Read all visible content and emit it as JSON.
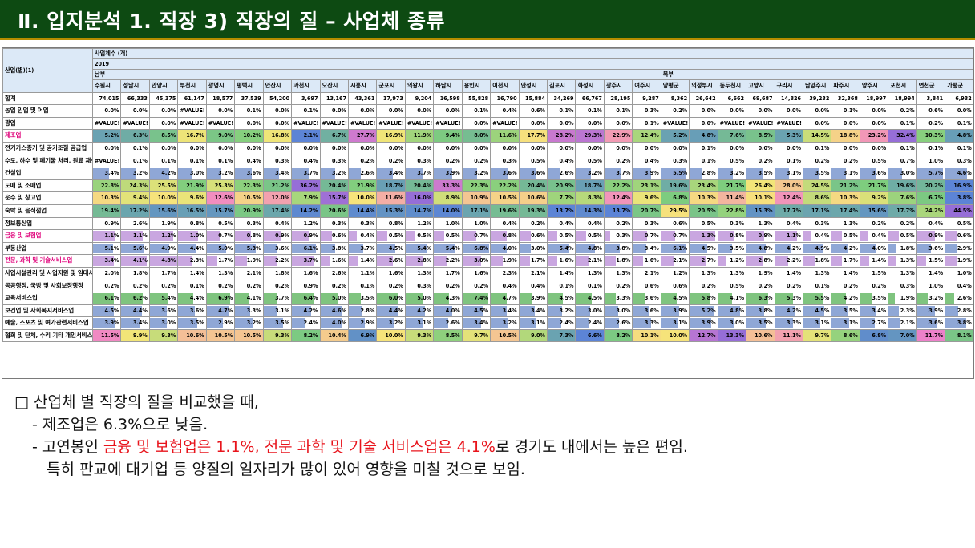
{
  "header": {
    "title": "Ⅱ. 입지분석 1. 직장 3) 직장의 질 – 사업체 종류",
    "bg_color": "#0d4a12",
    "rule_color": "#b58d00"
  },
  "table": {
    "corner_label": "산업(별)(1)",
    "top_header": "사업체수 (개)",
    "year": "2019",
    "region_south": "남부",
    "region_north": "북부",
    "south_count": 20,
    "cities": [
      "수원시",
      "성남시",
      "안양시",
      "부천시",
      "광명시",
      "평택시",
      "안산시",
      "과천시",
      "오산시",
      "시흥시",
      "군포시",
      "의왕시",
      "하남시",
      "용인시",
      "이천시",
      "안성시",
      "김포시",
      "화성시",
      "광주시",
      "여주시",
      "양평군",
      "의정부시",
      "동두천시",
      "고양시",
      "구리시",
      "남양주시",
      "파주시",
      "양주시",
      "포천시",
      "연천군",
      "가평군"
    ],
    "rows": [
      {
        "label": "합계",
        "type": "plain",
        "values": [
          "74,015",
          "66,333",
          "45,375",
          "61,147",
          "18,577",
          "37,539",
          "54,200",
          "3,697",
          "13,167",
          "43,361",
          "17,973",
          "9,204",
          "16,598",
          "55,828",
          "16,790",
          "15,884",
          "34,269",
          "66,767",
          "28,195",
          "9,287",
          "8,362",
          "26,642",
          "6,662",
          "69,687",
          "14,826",
          "39,232",
          "32,368",
          "18,997",
          "18,994",
          "3,841",
          "6,932"
        ]
      },
      {
        "label": "농업 임업 및 어업",
        "type": "plain",
        "values": [
          "0.0%",
          "0.0%",
          "0.0%",
          "#VALUE!",
          "0.0%",
          "0.1%",
          "0.0%",
          "0.1%",
          "0.0%",
          "0.0%",
          "0.0%",
          "0.0%",
          "0.0%",
          "0.1%",
          "0.4%",
          "0.6%",
          "0.1%",
          "0.1%",
          "0.1%",
          "0.3%",
          "0.2%",
          "0.0%",
          "0.0%",
          "0.0%",
          "0.0%",
          "0.0%",
          "0.1%",
          "0.0%",
          "0.2%",
          "0.6%",
          "0.0%"
        ]
      },
      {
        "label": "광업",
        "type": "plain",
        "values": [
          "#VALUE!",
          "#VALUE!",
          "0.0%",
          "#VALUE!",
          "#VALUE!",
          "0.0%",
          "0.0%",
          "#VALUE!",
          "#VALUE!",
          "#VALUE!",
          "#VALUE!",
          "#VALUE!",
          "#VALUE!",
          "0.0%",
          "#VALUE!",
          "0.0%",
          "0.0%",
          "0.0%",
          "0.0%",
          "0.1%",
          "#VALUE!",
          "0.0%",
          "#VALUE!",
          "#VALUE!",
          "#VALUE!",
          "0.0%",
          "0.0%",
          "0.0%",
          "0.1%",
          "0.2%",
          "0.1%"
        ]
      },
      {
        "label": "제조업",
        "type": "heat",
        "key": "manufacturing",
        "values": [
          "5.2%",
          "6.3%",
          "8.5%",
          "16.7%",
          "9.0%",
          "10.2%",
          "16.8%",
          "2.1%",
          "6.7%",
          "27.7%",
          "16.9%",
          "11.9%",
          "9.4%",
          "8.0%",
          "11.6%",
          "17.7%",
          "28.2%",
          "29.3%",
          "22.9%",
          "12.4%",
          "5.2%",
          "4.8%",
          "7.6%",
          "8.5%",
          "5.3%",
          "14.5%",
          "18.8%",
          "23.2%",
          "32.4%",
          "10.3%",
          "4.8%"
        ]
      },
      {
        "label": "전기가스증기 및 공기조절 공급업",
        "type": "plain",
        "values": [
          "0.0%",
          "0.1%",
          "0.0%",
          "0.0%",
          "0.0%",
          "0.0%",
          "0.0%",
          "0.0%",
          "0.0%",
          "0.0%",
          "0.0%",
          "0.0%",
          "0.0%",
          "0.0%",
          "0.0%",
          "0.0%",
          "0.0%",
          "0.0%",
          "0.0%",
          "0.0%",
          "0.0%",
          "0.1%",
          "0.0%",
          "0.0%",
          "0.0%",
          "0.1%",
          "0.0%",
          "0.0%",
          "0.1%",
          "0.1%",
          "0.1%"
        ]
      },
      {
        "label": "수도, 하수 및 폐기물 처리, 원료 재생업",
        "type": "plain",
        "values": [
          "#VALUE!",
          "0.1%",
          "0.1%",
          "0.1%",
          "0.1%",
          "0.4%",
          "0.3%",
          "0.4%",
          "0.3%",
          "0.2%",
          "0.2%",
          "0.3%",
          "0.2%",
          "0.2%",
          "0.3%",
          "0.5%",
          "0.4%",
          "0.5%",
          "0.2%",
          "0.4%",
          "0.3%",
          "0.1%",
          "0.5%",
          "0.2%",
          "0.1%",
          "0.2%",
          "0.2%",
          "0.5%",
          "0.7%",
          "1.0%",
          "0.3%"
        ]
      },
      {
        "label": "건설업",
        "type": "bar",
        "color": "#8fa7d6",
        "max": 6,
        "values": [
          "3.4%",
          "3.2%",
          "4.2%",
          "3.0%",
          "3.2%",
          "3.6%",
          "3.4%",
          "3.7%",
          "3.2%",
          "2.6%",
          "3.4%",
          "3.7%",
          "3.9%",
          "3.2%",
          "3.6%",
          "3.6%",
          "2.6%",
          "3.2%",
          "3.7%",
          "3.9%",
          "5.5%",
          "2.8%",
          "3.2%",
          "3.5%",
          "3.1%",
          "3.5%",
          "3.1%",
          "3.6%",
          "3.0%",
          "5.7%",
          "4.6%"
        ]
      },
      {
        "label": "도매 및 소매업",
        "type": "heat",
        "key": "wholesale",
        "values": [
          "22.8%",
          "24.3%",
          "25.5%",
          "21.9%",
          "25.3%",
          "22.3%",
          "21.2%",
          "36.2%",
          "20.4%",
          "21.9%",
          "18.7%",
          "20.4%",
          "33.3%",
          "22.3%",
          "22.2%",
          "20.4%",
          "20.9%",
          "18.7%",
          "22.2%",
          "23.1%",
          "19.6%",
          "23.4%",
          "21.7%",
          "26.4%",
          "28.0%",
          "24.5%",
          "21.2%",
          "21.7%",
          "19.6%",
          "20.2%",
          "16.9%"
        ]
      },
      {
        "label": "운수 및 창고업",
        "type": "heat",
        "key": "transport",
        "values": [
          "10.3%",
          "9.4%",
          "10.0%",
          "9.6%",
          "12.6%",
          "10.5%",
          "12.0%",
          "7.9%",
          "15.7%",
          "10.0%",
          "11.6%",
          "16.0%",
          "8.9%",
          "10.9%",
          "10.5%",
          "10.6%",
          "7.7%",
          "8.3%",
          "12.4%",
          "9.6%",
          "6.8%",
          "10.3%",
          "11.4%",
          "10.1%",
          "12.4%",
          "8.6%",
          "10.3%",
          "9.2%",
          "7.6%",
          "6.7%",
          "3.8%"
        ]
      },
      {
        "label": "숙박 및 음식점업",
        "type": "heat",
        "key": "food",
        "values": [
          "19.4%",
          "17.2%",
          "15.6%",
          "16.5%",
          "15.7%",
          "20.9%",
          "17.4%",
          "14.2%",
          "20.6%",
          "14.4%",
          "15.3%",
          "14.7%",
          "14.0%",
          "17.1%",
          "19.6%",
          "19.3%",
          "13.7%",
          "14.3%",
          "13.7%",
          "20.7%",
          "29.5%",
          "20.5%",
          "22.8%",
          "15.3%",
          "17.7%",
          "17.1%",
          "17.4%",
          "15.6%",
          "17.7%",
          "24.2%",
          "44.5%"
        ]
      },
      {
        "label": "정보통신업",
        "type": "plain",
        "values": [
          "0.9%",
          "2.6%",
          "1.9%",
          "0.8%",
          "0.5%",
          "0.3%",
          "0.4%",
          "1.2%",
          "0.3%",
          "0.3%",
          "0.8%",
          "1.2%",
          "1.0%",
          "1.0%",
          "0.4%",
          "0.2%",
          "0.4%",
          "0.4%",
          "0.2%",
          "0.3%",
          "0.6%",
          "0.5%",
          "0.3%",
          "1.3%",
          "0.4%",
          "0.3%",
          "1.3%",
          "0.2%",
          "0.2%",
          "0.4%",
          "0.5%"
        ]
      },
      {
        "label": "금융 및 보험업",
        "type": "bar",
        "color": "#c9a6e0",
        "max": 1.4,
        "key": "finance",
        "values": [
          "1.1%",
          "1.1%",
          "1.2%",
          "1.0%",
          "0.7%",
          "0.8%",
          "0.9%",
          "0.9%",
          "0.6%",
          "0.4%",
          "0.5%",
          "0.5%",
          "0.5%",
          "0.7%",
          "0.8%",
          "0.6%",
          "0.5%",
          "0.5%",
          "0.3%",
          "0.7%",
          "0.7%",
          "1.3%",
          "0.8%",
          "0.9%",
          "1.1%",
          "0.4%",
          "0.5%",
          "0.4%",
          "0.5%",
          "0.9%",
          "0.6%"
        ]
      },
      {
        "label": "부동산업",
        "type": "bar",
        "color": "#8fa7d6",
        "max": 7,
        "values": [
          "5.1%",
          "5.6%",
          "4.9%",
          "4.4%",
          "5.0%",
          "5.3%",
          "3.6%",
          "6.1%",
          "3.8%",
          "3.7%",
          "4.5%",
          "5.4%",
          "5.4%",
          "6.8%",
          "4.0%",
          "3.0%",
          "5.4%",
          "4.8%",
          "3.8%",
          "3.4%",
          "6.1%",
          "4.5%",
          "3.5%",
          "4.8%",
          "4.2%",
          "4.9%",
          "4.2%",
          "4.0%",
          "1.8%",
          "3.6%",
          "2.9%"
        ]
      },
      {
        "label": "전문, 과학 및 기술서비스업",
        "type": "bar",
        "color": "#c9a6e0",
        "max": 4.5,
        "key": "professional",
        "values": [
          "3.4%",
          "4.1%",
          "4.8%",
          "2.3%",
          "1.7%",
          "1.9%",
          "2.2%",
          "3.7%",
          "1.6%",
          "1.4%",
          "2.6%",
          "2.8%",
          "2.2%",
          "3.0%",
          "1.9%",
          "1.7%",
          "1.6%",
          "2.1%",
          "1.8%",
          "1.6%",
          "2.1%",
          "2.7%",
          "1.2%",
          "2.8%",
          "2.2%",
          "1.8%",
          "1.7%",
          "1.4%",
          "1.3%",
          "1.5%",
          "1.9%"
        ]
      },
      {
        "label": "사업시설관리 및 사업지원 및 임대서비스업",
        "type": "plain",
        "values": [
          "2.0%",
          "1.8%",
          "1.7%",
          "1.4%",
          "1.3%",
          "2.1%",
          "1.8%",
          "1.6%",
          "2.6%",
          "1.1%",
          "1.6%",
          "1.3%",
          "1.7%",
          "1.6%",
          "2.3%",
          "2.1%",
          "1.4%",
          "1.3%",
          "1.3%",
          "2.1%",
          "1.2%",
          "1.3%",
          "1.3%",
          "1.9%",
          "1.4%",
          "1.3%",
          "1.4%",
          "1.5%",
          "1.3%",
          "1.4%",
          "1.0%"
        ]
      },
      {
        "label": "공공행정, 국방 및 사회보장행정",
        "type": "plain",
        "values": [
          "0.2%",
          "0.2%",
          "0.2%",
          "0.1%",
          "0.2%",
          "0.2%",
          "0.2%",
          "0.9%",
          "0.2%",
          "0.1%",
          "0.2%",
          "0.3%",
          "0.2%",
          "0.2%",
          "0.4%",
          "0.4%",
          "0.1%",
          "0.1%",
          "0.2%",
          "0.6%",
          "0.6%",
          "0.2%",
          "0.5%",
          "0.2%",
          "0.2%",
          "0.1%",
          "0.2%",
          "0.2%",
          "0.3%",
          "1.0%",
          "0.4%"
        ]
      },
      {
        "label": "교육서비스업",
        "type": "bar",
        "color": "#7fc47f",
        "max": 8,
        "values": [
          "6.1%",
          "6.2%",
          "5.4%",
          "4.4%",
          "6.9%",
          "4.1%",
          "3.7%",
          "6.4%",
          "5.0%",
          "3.5%",
          "6.0%",
          "5.0%",
          "4.3%",
          "7.4%",
          "4.7%",
          "3.9%",
          "4.5%",
          "4.5%",
          "3.3%",
          "3.6%",
          "4.5%",
          "5.8%",
          "4.1%",
          "6.3%",
          "5.3%",
          "5.5%",
          "4.2%",
          "3.5%",
          "1.9%",
          "3.2%",
          "2.6%"
        ]
      },
      {
        "label": "보건업 및 사회복지서비스업",
        "type": "bar",
        "color": "#8fa7d6",
        "max": 6,
        "values": [
          "4.5%",
          "4.4%",
          "3.6%",
          "3.6%",
          "4.7%",
          "3.3%",
          "3.1%",
          "4.2%",
          "4.6%",
          "2.8%",
          "4.4%",
          "4.2%",
          "4.0%",
          "4.5%",
          "3.4%",
          "3.4%",
          "3.2%",
          "3.0%",
          "3.0%",
          "3.6%",
          "3.9%",
          "5.2%",
          "4.8%",
          "3.8%",
          "4.2%",
          "4.5%",
          "3.5%",
          "3.4%",
          "2.3%",
          "3.9%",
          "2.8%"
        ]
      },
      {
        "label": "예술, 스포츠 및 여가관련서비스업",
        "type": "bar",
        "color": "#8fa7d6",
        "max": 5,
        "values": [
          "3.9%",
          "3.4%",
          "3.0%",
          "3.5%",
          "2.9%",
          "3.2%",
          "3.5%",
          "2.4%",
          "4.0%",
          "2.9%",
          "3.2%",
          "3.1%",
          "2.6%",
          "3.4%",
          "3.2%",
          "3.1%",
          "2.4%",
          "2.4%",
          "2.6%",
          "3.3%",
          "3.1%",
          "3.9%",
          "3.0%",
          "3.5%",
          "3.3%",
          "3.1%",
          "3.1%",
          "2.7%",
          "2.1%",
          "3.6%",
          "3.8%"
        ]
      },
      {
        "label": "협회 및 단체, 수리 기타 개인서비스업",
        "type": "heat",
        "key": "association",
        "values": [
          "11.5%",
          "9.9%",
          "9.3%",
          "10.6%",
          "10.5%",
          "10.5%",
          "9.3%",
          "8.2%",
          "10.4%",
          "6.9%",
          "10.0%",
          "9.3%",
          "8.5%",
          "9.7%",
          "10.5%",
          "9.0%",
          "7.3%",
          "6.6%",
          "8.2%",
          "10.1%",
          "10.0%",
          "12.7%",
          "13.3%",
          "10.6%",
          "11.1%",
          "9.7%",
          "8.6%",
          "6.8%",
          "7.0%",
          "11.7%",
          "8.1%"
        ]
      }
    ]
  },
  "notes": {
    "line1": "□ 산업체 별 직장의 질을 비교했을 때,",
    "line2": "- 제조업은 6.3%으로 낮음.",
    "line3_pre": "- 고연봉인 ",
    "line3_red": "금융 및 보험업은 1.1%, 전문 과학 및 기술 서비스업은 4.1%",
    "line3_post": "로 경기도 내에서는 높은 편임.",
    "line4": "특히 판교에 대기업 등 양질의 일자리가 많이 있어 영향을 미칠 것으로 보임.",
    "highlight_color": "#e8141c"
  }
}
